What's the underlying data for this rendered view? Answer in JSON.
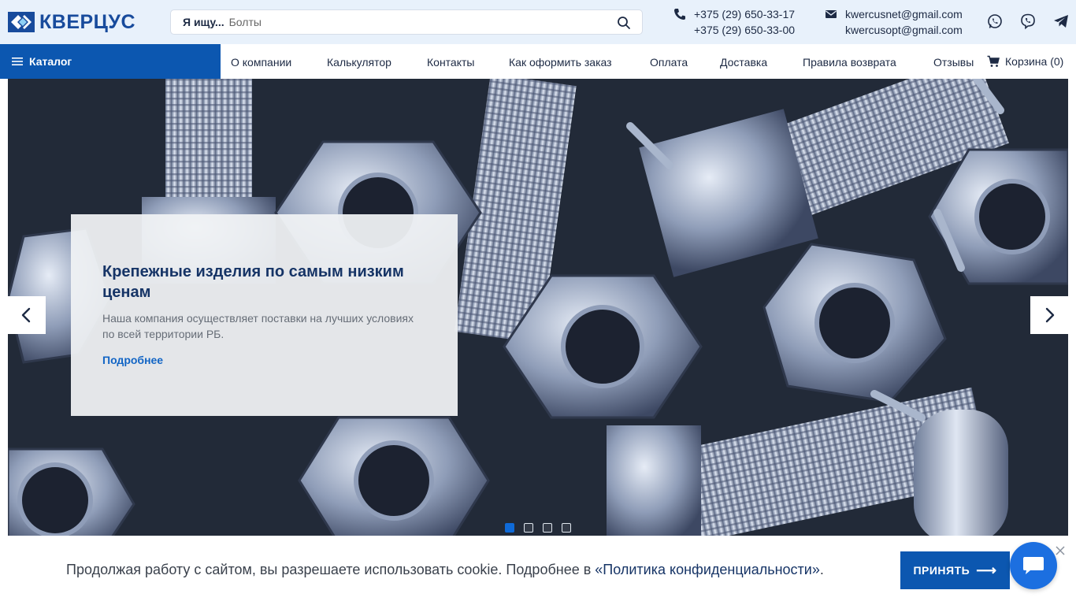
{
  "brand": {
    "name": "КВЕРЦУС",
    "color": "#184b9c"
  },
  "search": {
    "label": "Я ищу...",
    "placeholder": "Болты"
  },
  "contacts": {
    "phones": [
      "+375 (29) 650-33-17",
      "+375 (29) 650-33-00"
    ],
    "emails": [
      "kwercusnet@gmail.com",
      "kwercusopt@gmail.com"
    ],
    "icons": [
      "phone-icon",
      "mail-icon",
      "whatsapp-icon",
      "viber-icon",
      "telegram-icon"
    ]
  },
  "nav": {
    "catalog": "Каталог",
    "links": [
      "О компании",
      "Калькулятор",
      "Контакты",
      "Как оформить заказ",
      "Оплата",
      "Доставка",
      "Правила возврата",
      "Отзывы"
    ],
    "cart": "Корзина (0)"
  },
  "slider": {
    "title": "Крепежные изделия по самым низким ценам",
    "text": "Наша компания осуществляет поставки на лучших условиях по всей территории РБ.",
    "link": "Подробнее",
    "slides_total": 4,
    "active_slide": 1
  },
  "cookie": {
    "text": "Продолжая работу с сайтом, вы разрешаете использовать cookie. Подробнее в ",
    "link": "«Политика конфиденциальности»",
    "suffix": ".",
    "accept": "ПРИНЯТЬ",
    "accept_arrow": "⟶"
  },
  "colors": {
    "accent": "#0c57b0",
    "header_bg": "#e8f1fb",
    "link": "#1265c5"
  }
}
